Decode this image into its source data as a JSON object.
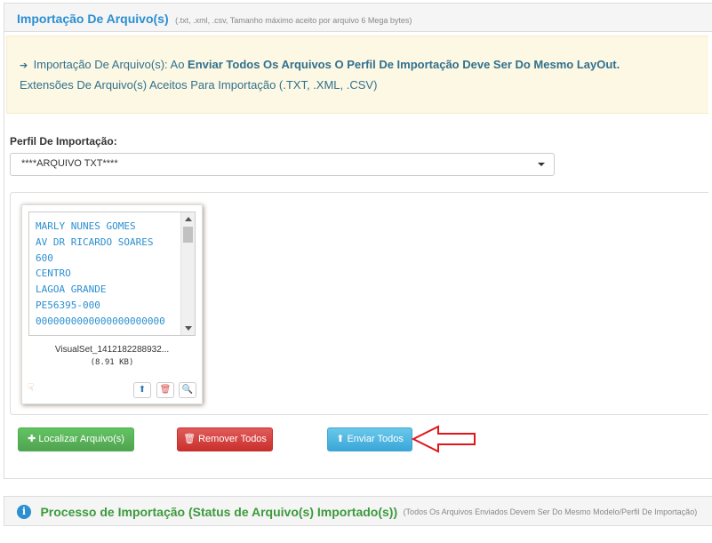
{
  "header": {
    "title": "Importação De Arquivo(s)",
    "subtitle": "(.txt, .xml, .csv, Tamanho máximo aceito por arquivo 6 Mega bytes)"
  },
  "alert": {
    "icon": "sign-in-icon",
    "line1_prefix": "Importação De Arquivo(s): Ao ",
    "line1_bold": "Enviar Todos Os Arquivos O Perfil De Importação Deve Ser Do Mesmo LayOut.",
    "line2": "Extensões De Arquivo(s) Aceitos Para Importação (.TXT, .XML, .CSV)"
  },
  "profile": {
    "label": "Perfil De Importação:",
    "selected": "****ARQUIVO TXT****"
  },
  "file": {
    "preview_text": "MARLY NUNES GOMES\nAV DR RICARDO SOARES\n600\nCENTRO\nLAGOA GRANDE\nPE56395-000\n0000000000000000000000",
    "name": "VisualSet_1412182288932...",
    "size": "(8.91 KB)"
  },
  "buttons": {
    "locate": "Localizar Arquivo(s)",
    "remove_all": "Remover Todos",
    "send_all": "Enviar Todos"
  },
  "status_panel": {
    "title": "Processo de Importação (Status de Arquivo(s) Importado(s))",
    "subtitle": "(Todos Os Arquivos Enviados Devem Ser Do Mesmo Modelo/Perfil De Importação)"
  },
  "colors": {
    "accent_blue": "#2b8fd1",
    "success_green": "#5cb85c",
    "danger_red": "#d9534f",
    "info_blue": "#5bc0de",
    "arrow_red": "#e0161b"
  }
}
